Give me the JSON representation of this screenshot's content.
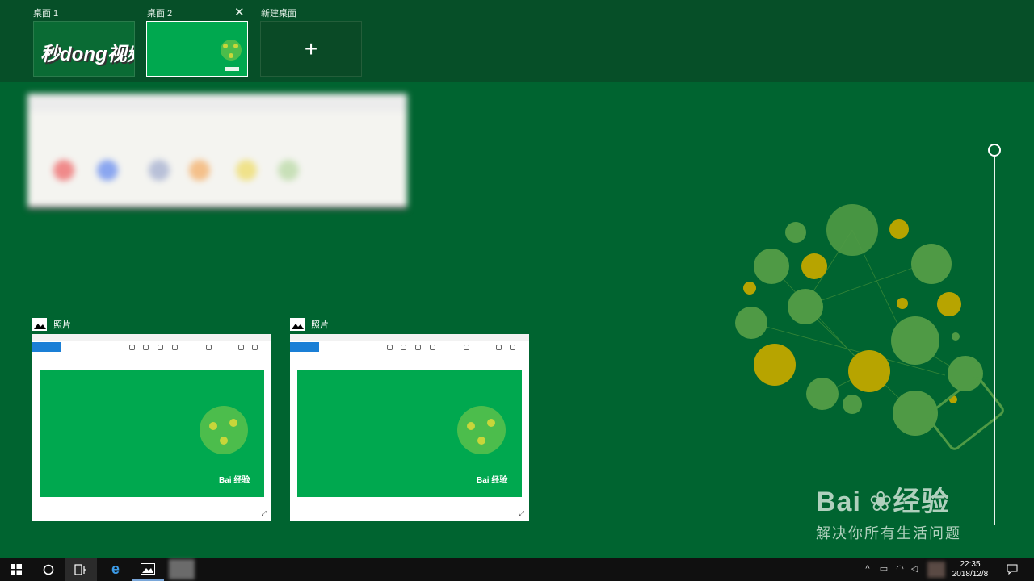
{
  "desktops": [
    {
      "label": "桌面 1",
      "watermark": "秒dong视频"
    },
    {
      "label": "桌面 2",
      "close": "✕"
    },
    {
      "label": "新建桌面",
      "plus": "+"
    }
  ],
  "windows": [
    {
      "app": "照片"
    },
    {
      "app": "照片"
    }
  ],
  "watermark": {
    "brand": "Bai",
    "brand2": "经验",
    "tagline": "解决你所有生活问题"
  },
  "clock": {
    "time": "22:35",
    "date": "2018/12/8"
  },
  "colors": {
    "background": "#006430",
    "bar": "#064f28",
    "taskbar": "#101010",
    "accent": "#1a7fd6"
  }
}
